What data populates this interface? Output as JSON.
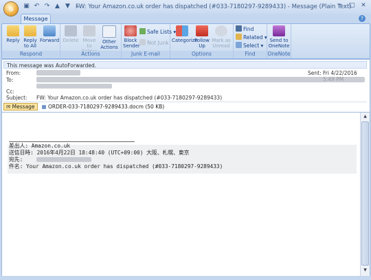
{
  "window": {
    "title": "FW: Your Amazon.co.uk order has dispatched (#033-7180297-9289433) - Message (Plain Text)"
  },
  "tabs": {
    "message": "Message"
  },
  "ribbon": {
    "respond": {
      "label": "Respond",
      "reply": "Reply",
      "reply_all": "Reply to All",
      "forward": "Forward"
    },
    "actions": {
      "label": "Actions",
      "delete": "Delete",
      "move_to_folder": "Move to Folder",
      "other_actions": "Other Actions"
    },
    "junk": {
      "label": "Junk E-mail",
      "block_sender": "Block Sender",
      "safe_lists": "Safe Lists",
      "not_junk": "Not Junk"
    },
    "options": {
      "label": "Options",
      "categorize": "Categorize",
      "follow_up": "Follow Up",
      "mark_unread": "Mark as Unread"
    },
    "find": {
      "label": "Find",
      "find": "Find",
      "related": "Related",
      "select": "Select"
    },
    "onenote": {
      "label": "OneNote",
      "send": "Send to OneNote"
    }
  },
  "header": {
    "info": "This message was AutoForwarded.",
    "from_label": "From:",
    "to_label": "To:",
    "cc_label": "Cc:",
    "subject_label": "Subject:",
    "subject": "FW: Your Amazon.co.uk order has dispatched (#033-7180297-9289433)",
    "sent_label": "Sent:",
    "sent": "Fri 4/22/2016 5:49 PM",
    "message_tab": "Message",
    "attachment": "ORDER-033-7180297-9289433.docm (50 KB)"
  },
  "body": {
    "from_line": "差出人: Amazon.co.uk",
    "date_line": "送信日時: 2016年4月22日 18:48:40 (UTC+09:00) 大阪、札幌、東京",
    "to_line": "宛先:",
    "subject_line": "件名: Your Amazon.co.uk order has dispatched (#033-7180297-9289433)"
  }
}
